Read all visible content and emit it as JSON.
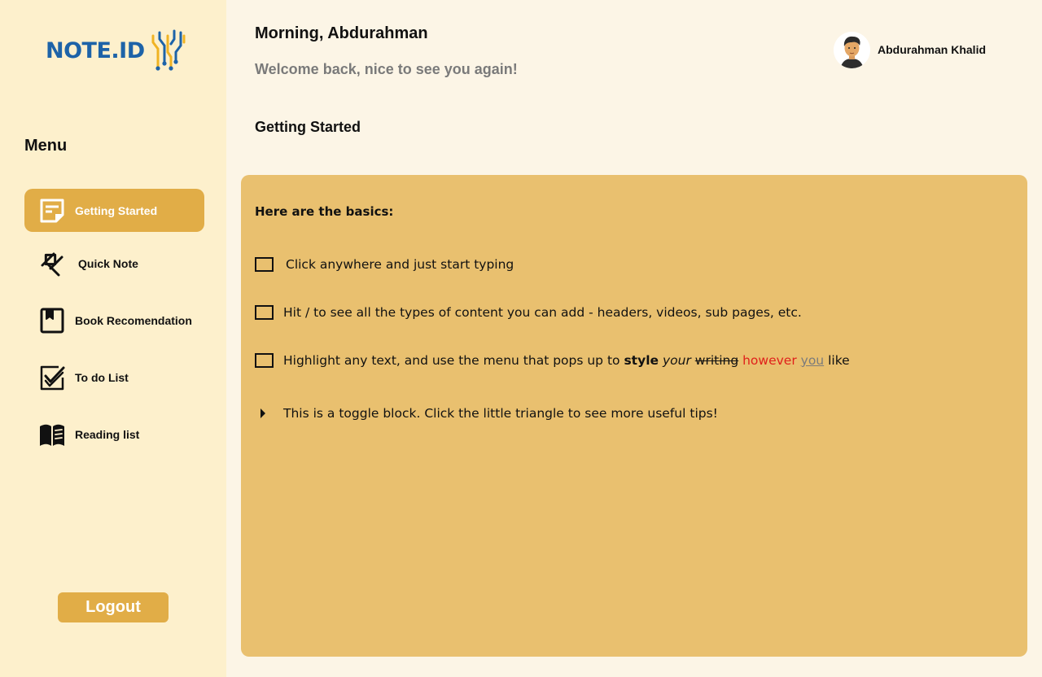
{
  "brand": {
    "logo_text": "NOTE.ID"
  },
  "colors": {
    "sidebar_bg": "#fdf0cc",
    "accent": "#e1ad47",
    "panel_bg": "#e9c06f",
    "page_bg": "#fcf5e6",
    "logo_blue": "#1d63a8"
  },
  "sidebar": {
    "menu_title": "Menu",
    "items": [
      {
        "label": "Getting Started",
        "icon": "note-icon",
        "active": true
      },
      {
        "label": "Quick Note",
        "icon": "pin-icon",
        "active": false
      },
      {
        "label": "Book Recomendation",
        "icon": "book-icon",
        "active": false
      },
      {
        "label": "To do List",
        "icon": "checklist-icon",
        "active": false
      },
      {
        "label": "Reading list",
        "icon": "open-book-icon",
        "active": false
      }
    ],
    "logout_label": "Logout"
  },
  "header": {
    "greeting": "Morning, Abdurahman",
    "subgreeting": "Welcome back, nice to see you again!",
    "user_name": "Abdurahman Khalid"
  },
  "main": {
    "section_title": "Getting Started",
    "panel": {
      "heading": "Here are the basics:",
      "checklist": [
        {
          "text": "Click anywhere and just start typing",
          "checked": false
        },
        {
          "text": "Hit / to see all the types of content you can add - headers, videos, sub pages, etc.",
          "checked": false
        },
        {
          "text_prefix": "Highlight any text, and use the menu that pops up to ",
          "bold": "style",
          "italic": "your",
          "strike": "writing",
          "red": "however",
          "underline": "you",
          "suffix": "like",
          "checked": false
        }
      ],
      "toggle_text": "This is a toggle block. Click the little triangle to see more useful tips!"
    }
  }
}
